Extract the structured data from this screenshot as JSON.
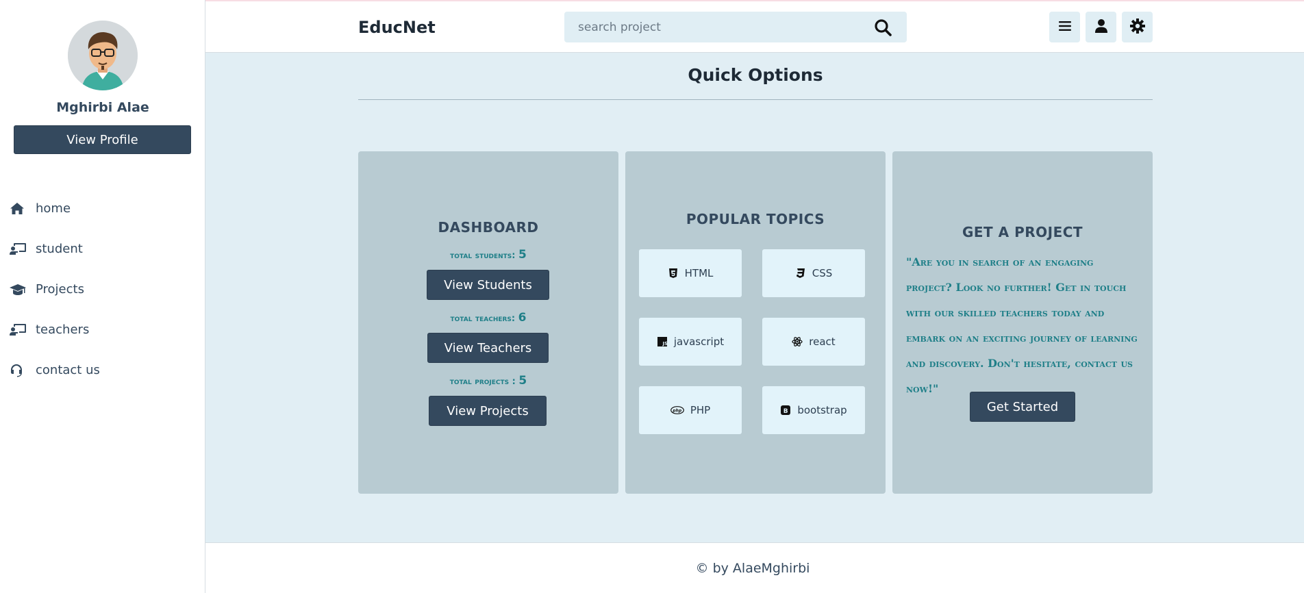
{
  "sidebar": {
    "profile_name": "Mghirbi Alae",
    "view_profile_label": "View Profile",
    "nav": [
      {
        "label": "home",
        "icon": "home-icon"
      },
      {
        "label": "student",
        "icon": "chalkboard-user-icon"
      },
      {
        "label": "Projects",
        "icon": "graduation-cap-icon"
      },
      {
        "label": "teachers",
        "icon": "chalkboard-teacher-icon"
      },
      {
        "label": "contact us",
        "icon": "headset-icon"
      }
    ]
  },
  "header": {
    "brand": "EducNet",
    "search_placeholder": "search project",
    "buttons": [
      "menu-icon",
      "user-icon",
      "settings-icon"
    ]
  },
  "main": {
    "title": "Quick Options",
    "dashboard": {
      "title": "DASHBOARD",
      "total_students_label": "total students: ",
      "total_students": "5",
      "view_students": "View Students",
      "total_teachers_label": "total teachers: ",
      "total_teachers": "6",
      "view_teachers": "View Teachers",
      "total_projects_label": "total projects : ",
      "total_projects": "5",
      "view_projects": "View Projects"
    },
    "topics": {
      "title": "POPULAR TOPICS",
      "items": [
        {
          "label": "HTML",
          "icon": "html5-icon"
        },
        {
          "label": "CSS",
          "icon": "css3-icon"
        },
        {
          "label": "javascript",
          "icon": "js-icon"
        },
        {
          "label": "react",
          "icon": "react-icon"
        },
        {
          "label": "PHP",
          "icon": "php-icon"
        },
        {
          "label": "bootstrap",
          "icon": "bootstrap-icon"
        }
      ]
    },
    "project": {
      "title": "GET A PROJECT",
      "quote": "\"Are you in search of an engaging project? Look no further! Get in touch with our skilled teachers today and embark on an exciting journey of learning and discovery. Don't hesitate, contact us now!\"",
      "cta": "Get Started"
    }
  },
  "footer": {
    "text": "© by AlaeMghirbi"
  },
  "colors": {
    "primary_dark": "#34495e",
    "accent_teal": "#1f7f88",
    "main_bg": "#e1eef4",
    "card_bg": "#b8cbd2",
    "topic_bg": "#e2f3fa"
  }
}
